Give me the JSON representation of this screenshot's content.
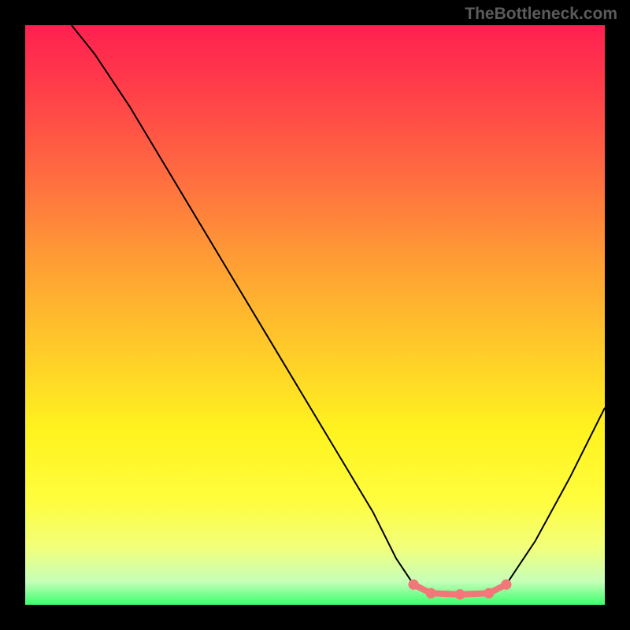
{
  "watermark": "TheBottleneck.com",
  "chart_data": {
    "type": "line",
    "title": "",
    "xlabel": "",
    "ylabel": "",
    "xlim": [
      0,
      100
    ],
    "ylim": [
      0,
      100
    ],
    "grid": false,
    "curve_points": [
      {
        "x": 8,
        "y": 100
      },
      {
        "x": 12,
        "y": 95
      },
      {
        "x": 18,
        "y": 86
      },
      {
        "x": 24,
        "y": 76
      },
      {
        "x": 30,
        "y": 66
      },
      {
        "x": 36,
        "y": 56
      },
      {
        "x": 42,
        "y": 46
      },
      {
        "x": 48,
        "y": 36
      },
      {
        "x": 54,
        "y": 26
      },
      {
        "x": 60,
        "y": 16
      },
      {
        "x": 64,
        "y": 8
      },
      {
        "x": 67,
        "y": 3.5
      },
      {
        "x": 70,
        "y": 2
      },
      {
        "x": 75,
        "y": 1.8
      },
      {
        "x": 80,
        "y": 2
      },
      {
        "x": 83,
        "y": 3.5
      },
      {
        "x": 88,
        "y": 11
      },
      {
        "x": 94,
        "y": 22
      },
      {
        "x": 100,
        "y": 34
      }
    ],
    "highlight_segment": {
      "start_x": 67,
      "end_x": 83,
      "color": "#f07878"
    },
    "background_gradient": {
      "top": "#ff2050",
      "mid_high": "#ff9b35",
      "mid": "#fff31f",
      "bottom": "#3bff6d"
    }
  }
}
